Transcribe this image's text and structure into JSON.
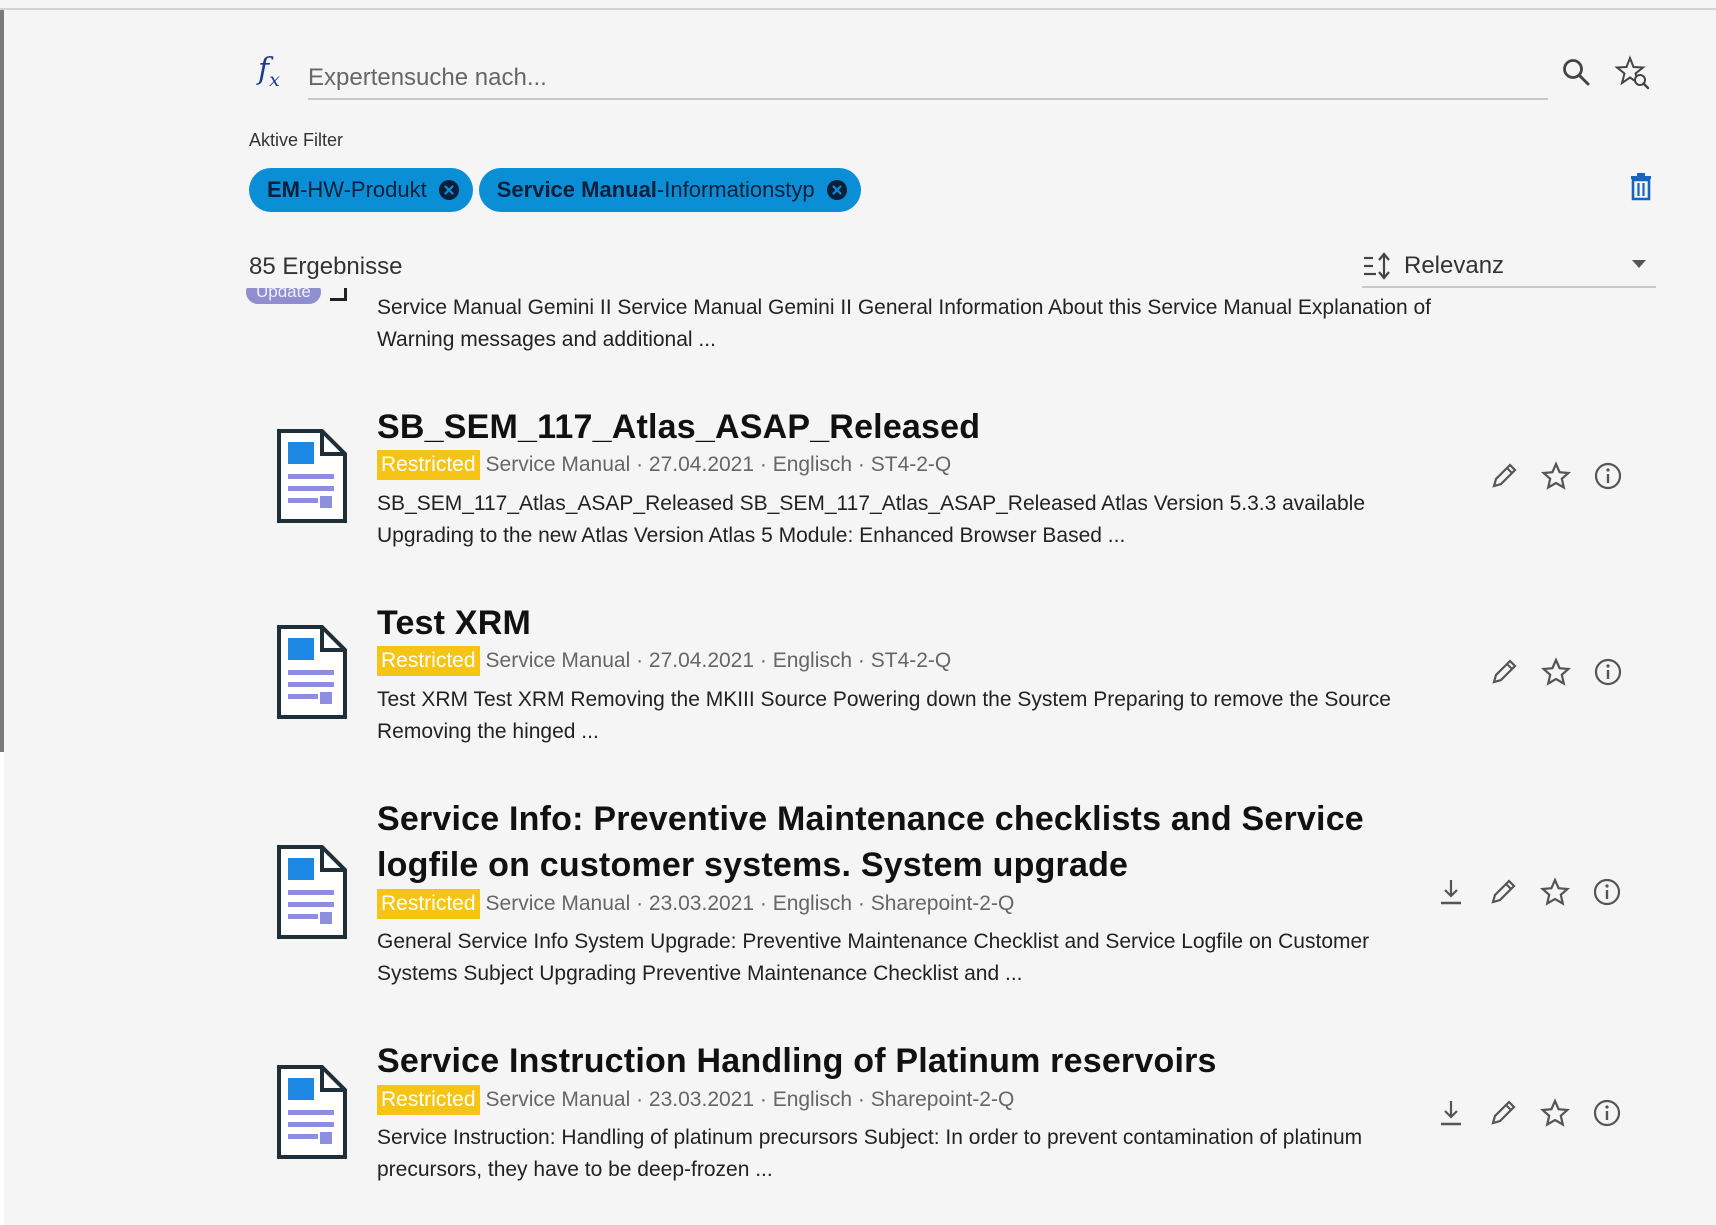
{
  "search": {
    "fx_label": "f",
    "fx_sub": "x",
    "placeholder": "Expertensuche nach..."
  },
  "filters": {
    "label": "Aktive Filter",
    "chips": [
      {
        "value": "EM",
        "sep": " - ",
        "type": "HW-Produkt"
      },
      {
        "value": "Service Manual",
        "sep": " - ",
        "type": "Informationstyp"
      }
    ]
  },
  "results": {
    "count": "85",
    "count_label": " Ergebnisse",
    "sort_label": "Relevanz"
  },
  "partial_item": {
    "badge": "Update",
    "snippet": "Service Manual Gemini II Service Manual Gemini II General Information About this Service Manual Explanation of Warning messages and additional ..."
  },
  "items": [
    {
      "title": "SB_SEM_117_Atlas_ASAP_Released",
      "badge": "Restricted",
      "meta": "Service Manual · 27.04.2021 · Englisch · ST4-2-Q",
      "snippet": " SB_SEM_117_Atlas_ASAP_Released SB_SEM_117_Atlas_ASAP_Released Atlas Version 5.3.3 available Upgrading to the new Atlas Version Atlas 5 Module: Enhanced Browser Based ..."
    },
    {
      "title": "Test XRM",
      "badge": "Restricted",
      "meta": "Service Manual · 27.04.2021 · Englisch · ST4-2-Q",
      "snippet": " Test XRM Test XRM Removing the MKIII Source Powering down the System Preparing to remove the Source Removing the hinged ..."
    },
    {
      "title": "Service Info: Preventive Maintenance checklists and Service logfile on customer systems. System upgrade",
      "badge": "Restricted",
      "meta": "Service Manual · 23.03.2021 · Englisch · Sharepoint-2-Q",
      "snippet": "General Service Info System Upgrade: Preventive Maintenance Checklist and Service Logfile on Customer Systems Subject Upgrading Preventive Maintenance Checklist and ..."
    },
    {
      "title": "Service Instruction Handling of Platinum reservoirs",
      "badge": "Restricted",
      "meta": "Service Manual · 23.03.2021 · Englisch · Sharepoint-2-Q",
      "snippet": "Service Instruction: Handling of platinum precursors Subject: In order to prevent contamination of platinum precursors, they have to be deep-frozen ..."
    }
  ],
  "colors": {
    "chip": "#0a8fd6",
    "restricted": "#f6c414",
    "update": "#8f8fcf",
    "trash": "#1565c0",
    "doc_blue": "#1e88e5",
    "doc_lines": "#8e8ee0"
  }
}
